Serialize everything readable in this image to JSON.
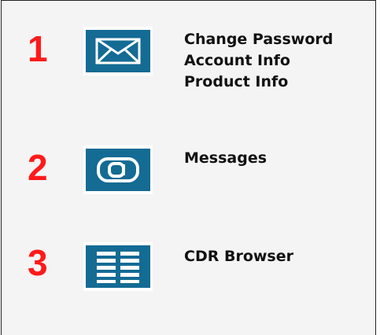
{
  "colors": {
    "number": "#ff1a1a",
    "icon_bg": "#146b94",
    "text": "#111111",
    "panel_bg": "#f4f4f4"
  },
  "sections": [
    {
      "number": "1",
      "icon": "envelope-icon",
      "items": [
        "Change Password",
        "Account Info",
        "Product Info"
      ]
    },
    {
      "number": "2",
      "icon": "at-sign-icon",
      "items": [
        "Messages"
      ]
    },
    {
      "number": "3",
      "icon": "list-icon",
      "items": [
        "CDR Browser"
      ]
    }
  ]
}
